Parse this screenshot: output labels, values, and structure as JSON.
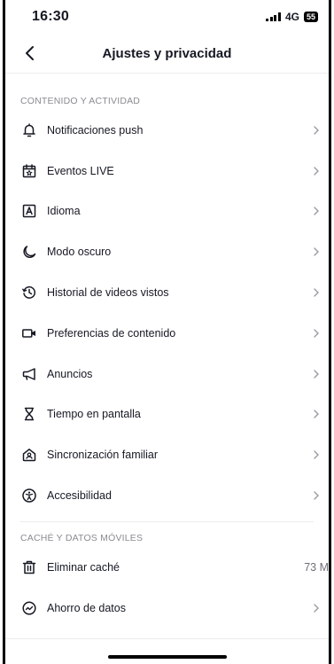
{
  "status_bar": {
    "time": "16:30",
    "network": "4G",
    "battery": "55"
  },
  "header": {
    "title": "Ajustes y privacidad",
    "back_icon": "chevron-left-icon"
  },
  "sections": [
    {
      "title": "CONTENIDO Y ACTIVIDAD",
      "items": [
        {
          "label": "Notificaciones push",
          "icon": "bell-icon"
        },
        {
          "label": "Eventos LIVE",
          "icon": "calendar-star-icon"
        },
        {
          "label": "Idioma",
          "icon": "language-icon"
        },
        {
          "label": "Modo oscuro",
          "icon": "moon-icon"
        },
        {
          "label": "Historial de videos vistos",
          "icon": "history-icon"
        },
        {
          "label": "Preferencias de contenido",
          "icon": "video-camera-icon"
        },
        {
          "label": "Anuncios",
          "icon": "megaphone-icon"
        },
        {
          "label": "Tiempo en pantalla",
          "icon": "hourglass-icon"
        },
        {
          "label": "Sincronización familiar",
          "icon": "family-home-icon"
        },
        {
          "label": "Accesibilidad",
          "icon": "accessibility-icon"
        }
      ]
    },
    {
      "title": "CACHÉ Y DATOS MÓVILES",
      "items": [
        {
          "label": "Eliminar caché",
          "icon": "trash-icon",
          "value": "73 M"
        },
        {
          "label": "Ahorro de datos",
          "icon": "data-saver-icon"
        }
      ]
    }
  ],
  "colors": {
    "text": "#161823",
    "muted": "#8a8b91",
    "divider": "#ececec"
  }
}
